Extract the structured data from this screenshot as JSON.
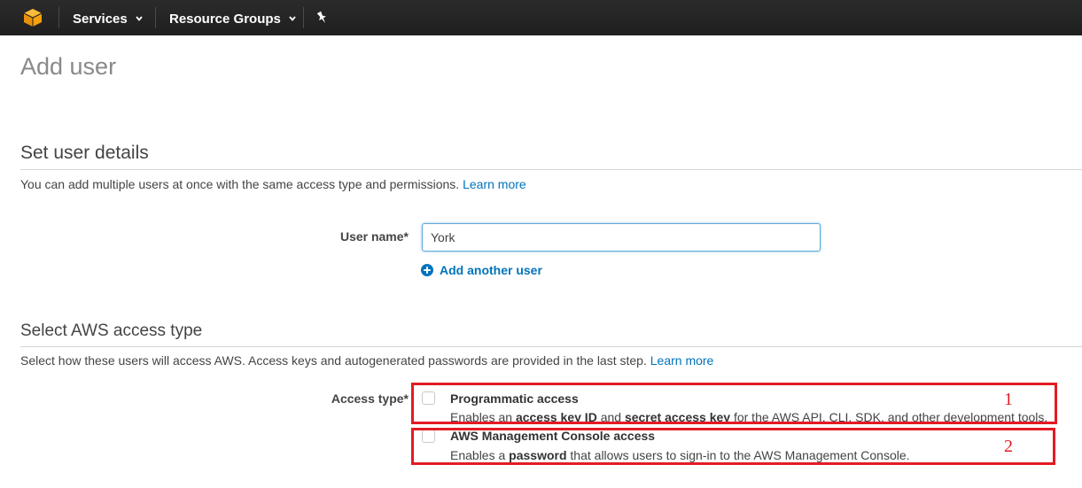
{
  "nav": {
    "logo_icon": "aws-cube-icon",
    "services_label": "Services",
    "resource_groups_label": "Resource Groups",
    "pin_icon": "pin-icon"
  },
  "page": {
    "title": "Add user"
  },
  "user_details": {
    "title": "Set user details",
    "description": "You can add multiple users at once with the same access type and permissions.",
    "learn_more": "Learn more",
    "user_name_label": "User name*",
    "user_name_value": "York",
    "add_another_user": "Add another user"
  },
  "access_type": {
    "title": "Select AWS access type",
    "description": "Select how these users will access AWS. Access keys and autogenerated passwords are provided in the last step.",
    "learn_more": "Learn more",
    "label": "Access type*",
    "options": [
      {
        "title": "Programmatic access",
        "desc_1": "Enables an ",
        "desc_b1": "access key ID",
        "desc_2": " and ",
        "desc_b2": "secret access key",
        "desc_3": " for the AWS API, CLI, SDK, and other development tools.",
        "checked": false
      },
      {
        "title": "AWS Management Console access",
        "desc_1": "Enables a ",
        "desc_b1": "password",
        "desc_2": " that allows users to sign-in to the AWS Management Console.",
        "checked": false
      }
    ]
  },
  "annotations": {
    "one": "1",
    "two": "2",
    "color": "#e31b23"
  },
  "colors": {
    "nav_bg": "#232f3e",
    "link": "#0073bb",
    "logo": "#f7a10d"
  }
}
